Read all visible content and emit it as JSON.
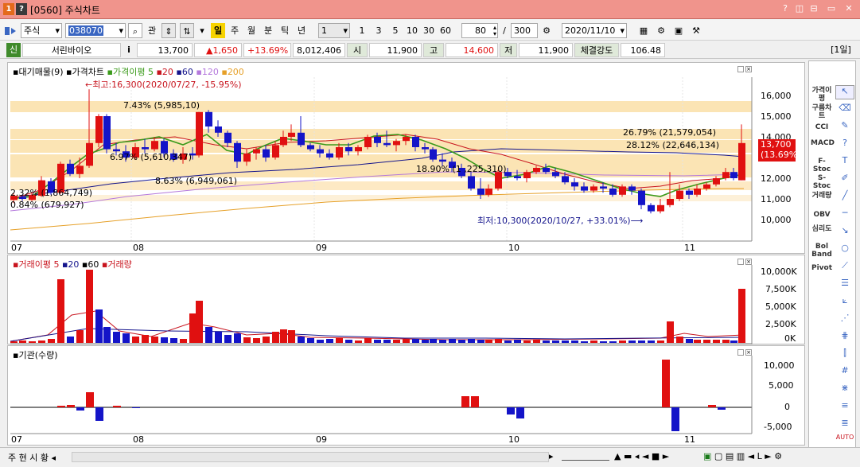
{
  "window": {
    "badge1": "1",
    "badge2": "?",
    "title": "[0560] 주식차트",
    "controls": [
      "?",
      "◫",
      "⊟",
      "▭",
      "✕"
    ]
  },
  "toolbar": {
    "market_select": "주식",
    "code": "038070",
    "btn_gwan": "관",
    "period_buttons": [
      "일",
      "주",
      "월",
      "분",
      "틱",
      "년"
    ],
    "active_period": "일",
    "count_select": "1",
    "minute_buttons": [
      "1",
      "3",
      "5",
      "10",
      "30",
      "60"
    ],
    "zoom_value": "80",
    "slash": "/",
    "total_value": "300",
    "date": "2020/11/10"
  },
  "quote": {
    "badge": "신",
    "name": "서린바이오",
    "info": "i",
    "price": "13,700",
    "change": "▲1,650",
    "pct": "+13.69%",
    "volume": "8,012,406",
    "open_label": "시",
    "open": "11,900",
    "high_label": "고",
    "high": "14,600",
    "low_label": "저",
    "low": "11,900",
    "strength_label": "체결강도",
    "strength": "106.48",
    "period_tag": "[1일]"
  },
  "price_panel": {
    "legend": {
      "vp": "대기매물(9)",
      "chart": "가격차트",
      "ma_label": "가격이평",
      "ma5": "5",
      "ma20": "20",
      "ma60": "60",
      "ma120": "120",
      "ma200": "200"
    },
    "annotations": {
      "high": "←최고:16,300(2020/07/27, -15.95%)",
      "low": "최저:10,300(2020/10/27, +33.01%)⟶",
      "vp1": "7.43% (5,985,10)",
      "vp2": "6.97% (5,610,347)",
      "vp3": "8.63% (6,949,061)",
      "vp4": "26.79% (21,579,054)",
      "vp5": "28.12% (22,646,134)",
      "vp6": "18.90% (1 ,225,310)",
      "vp7": "2.32% (1,864,749)",
      "vp8": "0.84% (679,927)"
    },
    "price_tag": {
      "value": "13,700",
      "pct": "(13.69%)"
    },
    "y_ticks": [
      "16,000",
      "15,000",
      "14,000",
      "13,000",
      "12,000",
      "11,000",
      "10,000"
    ],
    "x_ticks": [
      "07",
      "08",
      "09",
      "10",
      "11"
    ]
  },
  "volume_panel": {
    "legend": {
      "label": "거래이평",
      "ma5": "5",
      "ma20": "20",
      "ma60": "60",
      "vol": "거래량"
    },
    "y_ticks": [
      "10,000K",
      "7,500K",
      "5,000K",
      "2,500K",
      "0K"
    ]
  },
  "inst_panel": {
    "legend": "기관(수량)",
    "y_ticks": [
      "10,000",
      "5,000",
      "0",
      "-5,000"
    ],
    "x_ticks": [
      "07",
      "08",
      "09",
      "10",
      "11"
    ]
  },
  "right_tools": {
    "labels": [
      "가격이평",
      "구름차트",
      "CCI",
      "MACD",
      "F-Stoc",
      "S-Stoc",
      "거래량",
      "OBV",
      "심리도",
      "Bol Band",
      "Pivot"
    ]
  },
  "bottom": {
    "tabs": [
      "주",
      "현",
      "시",
      "황"
    ]
  },
  "colors": {
    "up": "#e01010",
    "down": "#1414c8",
    "ma5": "#3a9a1a",
    "ma20": "#c8141e",
    "ma60": "#14148c",
    "ma120": "#b478dc",
    "ma200": "#e6a028",
    "vp_band": "#fbe4b4"
  }
}
